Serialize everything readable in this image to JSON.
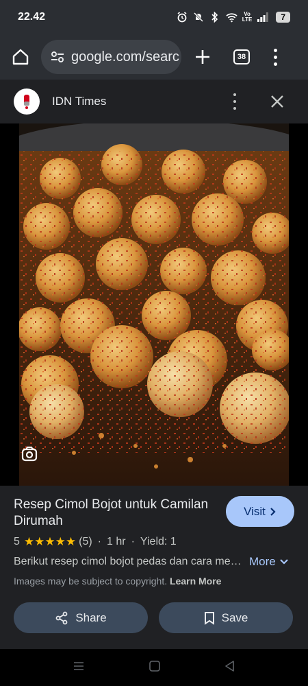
{
  "status_bar": {
    "time": "22.42",
    "volte_top": "Vo",
    "volte_bottom": "LTE",
    "battery": "7",
    "icons": [
      "alarm-icon",
      "mute-icon",
      "bluetooth-icon",
      "wifi-icon",
      "volte-icon",
      "signal-icon",
      "battery-icon"
    ]
  },
  "browser": {
    "url": "google.com/searc",
    "tab_count": "38",
    "icons": [
      "home-icon",
      "site-settings-icon",
      "new-tab-icon",
      "tabs-icon",
      "menu-icon"
    ]
  },
  "source": {
    "name": "IDN Times",
    "icons": [
      "source-logo",
      "more-options-icon",
      "close-icon"
    ]
  },
  "image": {
    "alt_icon": "lens-search-icon"
  },
  "result": {
    "title": "Resep Cimol Bojot untuk Camilan Dirumah",
    "visit_label": "Visit",
    "rating": "5",
    "stars": "★★★★★",
    "review_count": "(5)",
    "separator": "·",
    "time": "1 hr",
    "yield": "Yield: 1",
    "description": "Berikut resep cimol bojot pedas dan cara membuatnya",
    "more_label": "More",
    "copyright_text": "Images may be subject to copyright.",
    "learn_more": "Learn More",
    "share_label": "Share",
    "save_label": "Save"
  },
  "colors": {
    "accent": "#a8c7fa",
    "star": "#fbbc04",
    "panel_bg": "#202124",
    "toolbar_bg": "#2b2e33"
  },
  "nav": {
    "icons": [
      "recent-apps-icon",
      "home-nav-icon",
      "back-icon"
    ]
  }
}
